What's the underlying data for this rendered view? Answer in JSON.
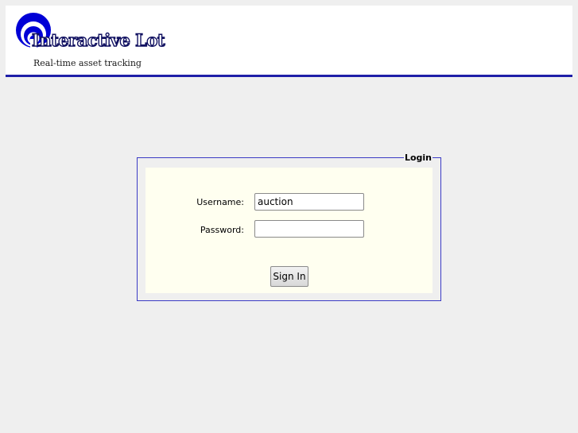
{
  "header": {
    "brand_name": "Interactive Lot",
    "tagline": "Real-time asset tracking"
  },
  "login": {
    "legend": "Login",
    "username_label": "Username:",
    "username_value": "auction",
    "password_label": "Password:",
    "password_value": "",
    "submit_label": "Sign In"
  },
  "colors": {
    "page_background": "#efefef",
    "accent_blue": "#1f1fa8",
    "form_background": "#fffff0"
  },
  "icons": {
    "logo_mark": "signal-arcs-icon"
  }
}
